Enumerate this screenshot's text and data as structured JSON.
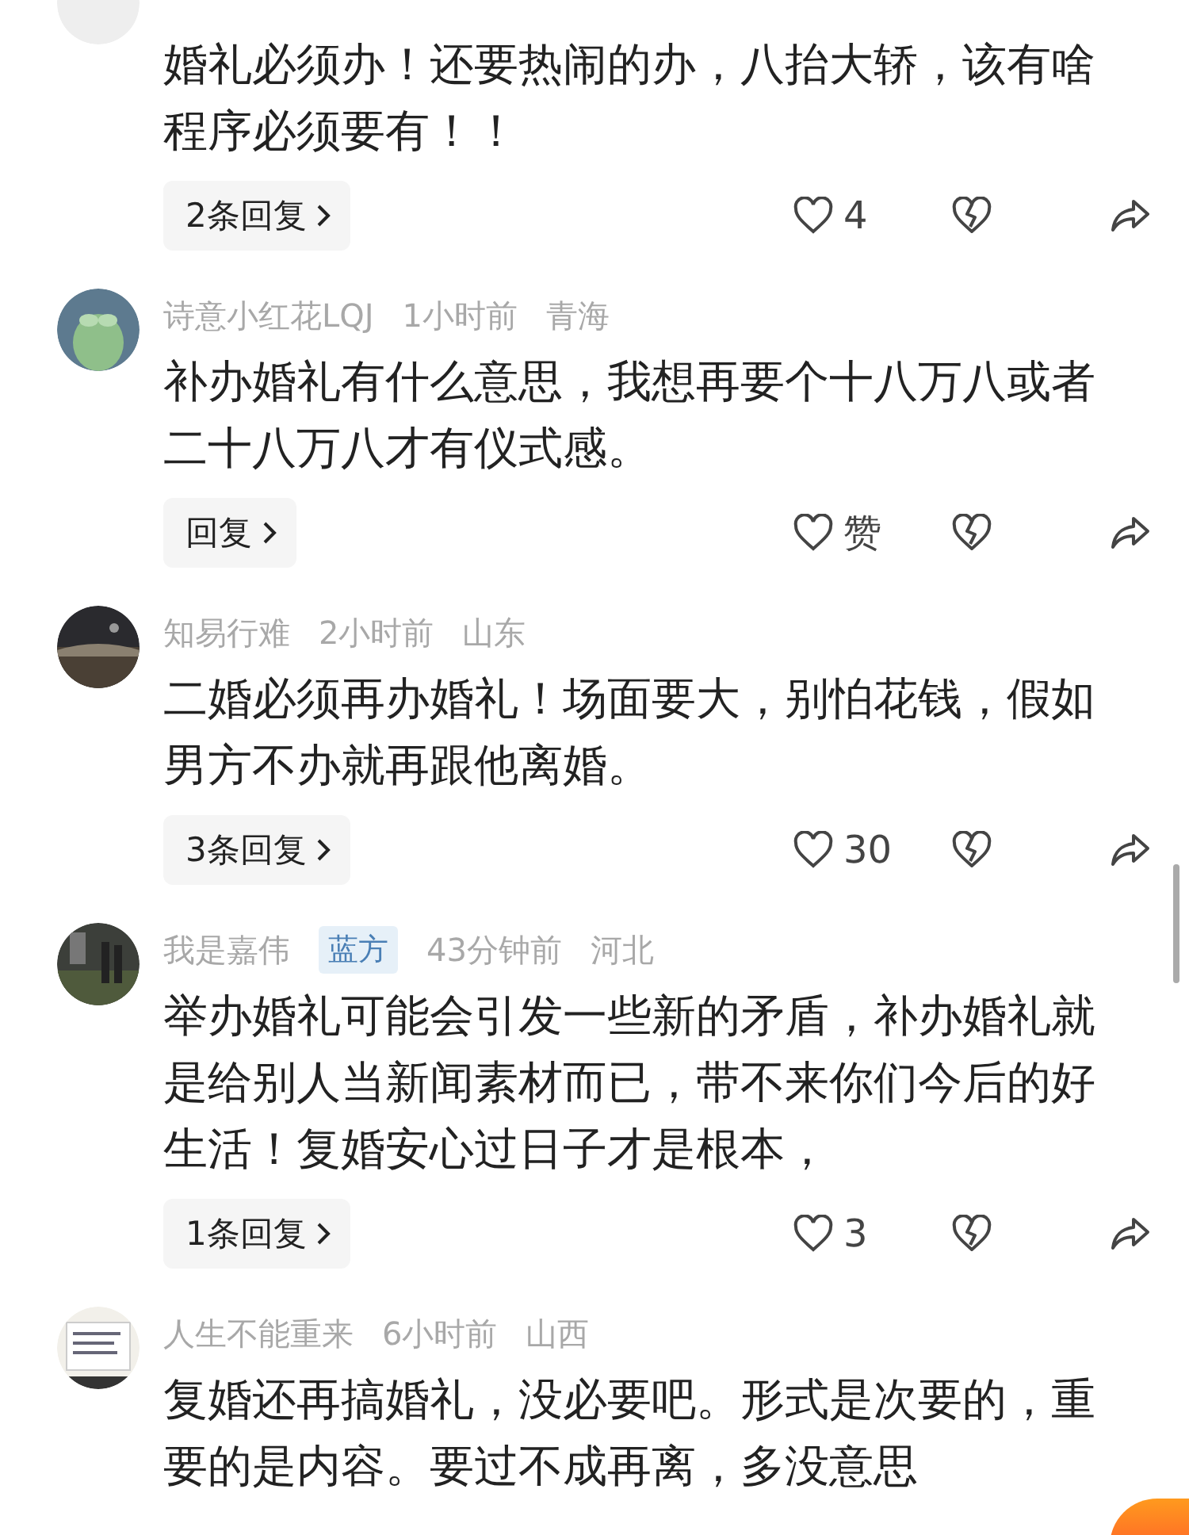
{
  "comments": [
    {
      "text": "婚礼必须办！还要热闹的办，八抬大轿，该有啥程序必须要有！！",
      "replies": "2条回复",
      "likes": "4"
    },
    {
      "author": "诗意小红花LQJ",
      "time": "1小时前",
      "location": "青海",
      "text": "补办婚礼有什么意思，我想再要个十八万八或者二十八万八才有仪式感。",
      "replies": "回复",
      "likes": "赞"
    },
    {
      "author": "知易行难",
      "time": "2小时前",
      "location": "山东",
      "text": "二婚必须再办婚礼！场面要大，别怕花钱，假如男方不办就再跟他离婚。",
      "replies": "3条回复",
      "likes": "30"
    },
    {
      "author": "我是嘉伟",
      "tag": "蓝方",
      "time": "43分钟前",
      "location": "河北",
      "text": "举办婚礼可能会引发一些新的矛盾，补办婚礼就是给别人当新闻素材而已，带不来你们今后的好生活！复婚安心过日子才是根本，",
      "replies": "1条回复",
      "likes": "3"
    },
    {
      "author": "人生不能重来",
      "time": "6小时前",
      "location": "山西",
      "text": "复婚还再搞婚礼，没必要吧。形式是次要的，重要的是内容。要过不成再离，多没意思"
    }
  ]
}
